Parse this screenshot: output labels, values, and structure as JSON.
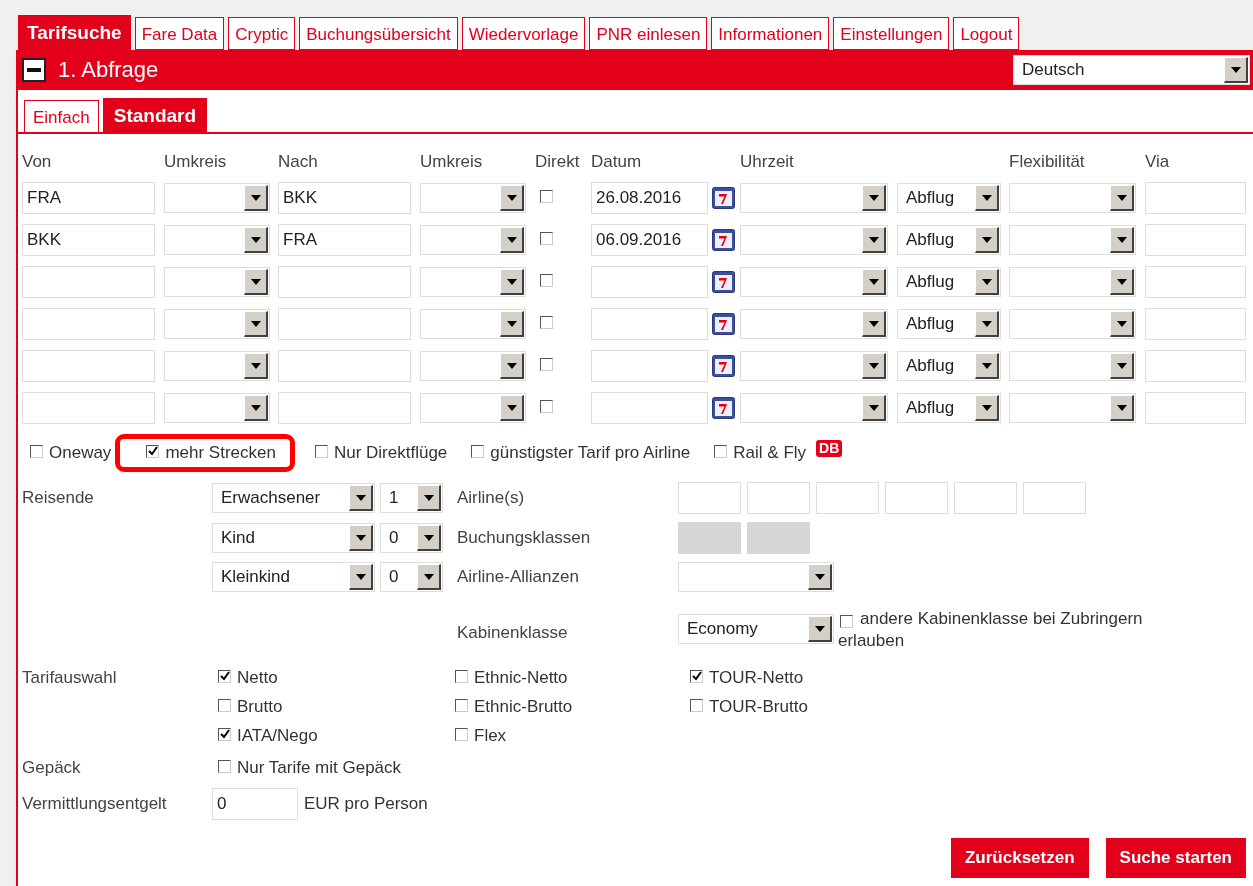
{
  "main_tabs": [
    {
      "label": "Tarifsuche",
      "selected": true
    },
    {
      "label": "Fare Data",
      "selected": false
    },
    {
      "label": "Cryptic",
      "selected": false
    },
    {
      "label": "Buchungsübersicht",
      "selected": false
    },
    {
      "label": "Wiedervorlage",
      "selected": false
    },
    {
      "label": "PNR einlesen",
      "selected": false
    },
    {
      "label": "Informationen",
      "selected": false
    },
    {
      "label": "Einstellungen",
      "selected": false
    },
    {
      "label": "Logout",
      "selected": false
    }
  ],
  "panel": {
    "title": "1. Abfrage",
    "language": "Deutsch"
  },
  "sub_tabs": [
    {
      "label": "Einfach",
      "selected": false
    },
    {
      "label": "Standard",
      "selected": true
    }
  ],
  "segment_columns": [
    "Von",
    "Umkreis",
    "Nach",
    "Umkreis",
    "Direkt",
    "Datum",
    "Uhrzeit",
    "Flexibilität",
    "Via"
  ],
  "segments": [
    {
      "from": "FRA",
      "to": "BKK",
      "direct": false,
      "date": "26.08.2016",
      "time_mode": "Abflug"
    },
    {
      "from": "BKK",
      "to": "FRA",
      "direct": false,
      "date": "06.09.2016",
      "time_mode": "Abflug"
    },
    {
      "direct": false,
      "time_mode": "Abflug"
    },
    {
      "direct": false,
      "time_mode": "Abflug"
    },
    {
      "direct": false,
      "time_mode": "Abflug"
    },
    {
      "direct": false,
      "time_mode": "Abflug"
    }
  ],
  "route_options": [
    {
      "label": "Oneway",
      "checked": false,
      "highlighted": false
    },
    {
      "label": "mehr Strecken",
      "checked": true,
      "highlighted": true
    },
    {
      "label": "Nur Direktflüge",
      "checked": false,
      "highlighted": false
    },
    {
      "label": "günstigster Tarif pro Airline",
      "checked": false,
      "highlighted": false
    },
    {
      "label": "Rail & Fly",
      "checked": false,
      "highlighted": false,
      "badge": "DB"
    }
  ],
  "travelers": {
    "label": "Reisende",
    "rows": [
      {
        "type": "Erwachsener",
        "count": "1"
      },
      {
        "type": "Kind",
        "count": "0"
      },
      {
        "type": "Kleinkind",
        "count": "0"
      }
    ]
  },
  "airlines": {
    "label": "Airline(s)",
    "fields": [
      {
        "disabled": false
      },
      {
        "disabled": false
      },
      {
        "disabled": false
      },
      {
        "disabled": false
      },
      {
        "disabled": false
      },
      {
        "disabled": false
      }
    ]
  },
  "booking_classes": {
    "label": "Buchungsklassen",
    "fields": [
      {
        "disabled": true
      },
      {
        "disabled": true
      }
    ]
  },
  "alliances": {
    "label": "Airline-Allianzen"
  },
  "cabin": {
    "label": "Kabinenklasse",
    "value": "Economy",
    "option": {
      "label": "andere Kabinenklasse bei Zubringern erlauben",
      "checked": false
    }
  },
  "fares": {
    "label": "Tarifauswahl",
    "columns": [
      [
        {
          "label": "Netto",
          "checked": true
        },
        {
          "label": "Brutto",
          "checked": false
        },
        {
          "label": "IATA/Nego",
          "checked": true
        }
      ],
      [
        {
          "label": "Ethnic-Netto",
          "checked": false
        },
        {
          "label": "Ethnic-Brutto",
          "checked": false
        },
        {
          "label": "Flex",
          "checked": false
        }
      ],
      [
        {
          "label": "TOUR-Netto",
          "checked": true
        },
        {
          "label": "TOUR-Brutto",
          "checked": false
        }
      ]
    ]
  },
  "baggage": {
    "label": "Gepäck",
    "option": {
      "label": "Nur Tarife mit Gepäck",
      "checked": false
    }
  },
  "fee": {
    "label": "Vermittlungsentgelt",
    "value": "0",
    "unit": "EUR pro Person"
  },
  "buttons": [
    "Zurücksetzen",
    "Suche starten"
  ]
}
